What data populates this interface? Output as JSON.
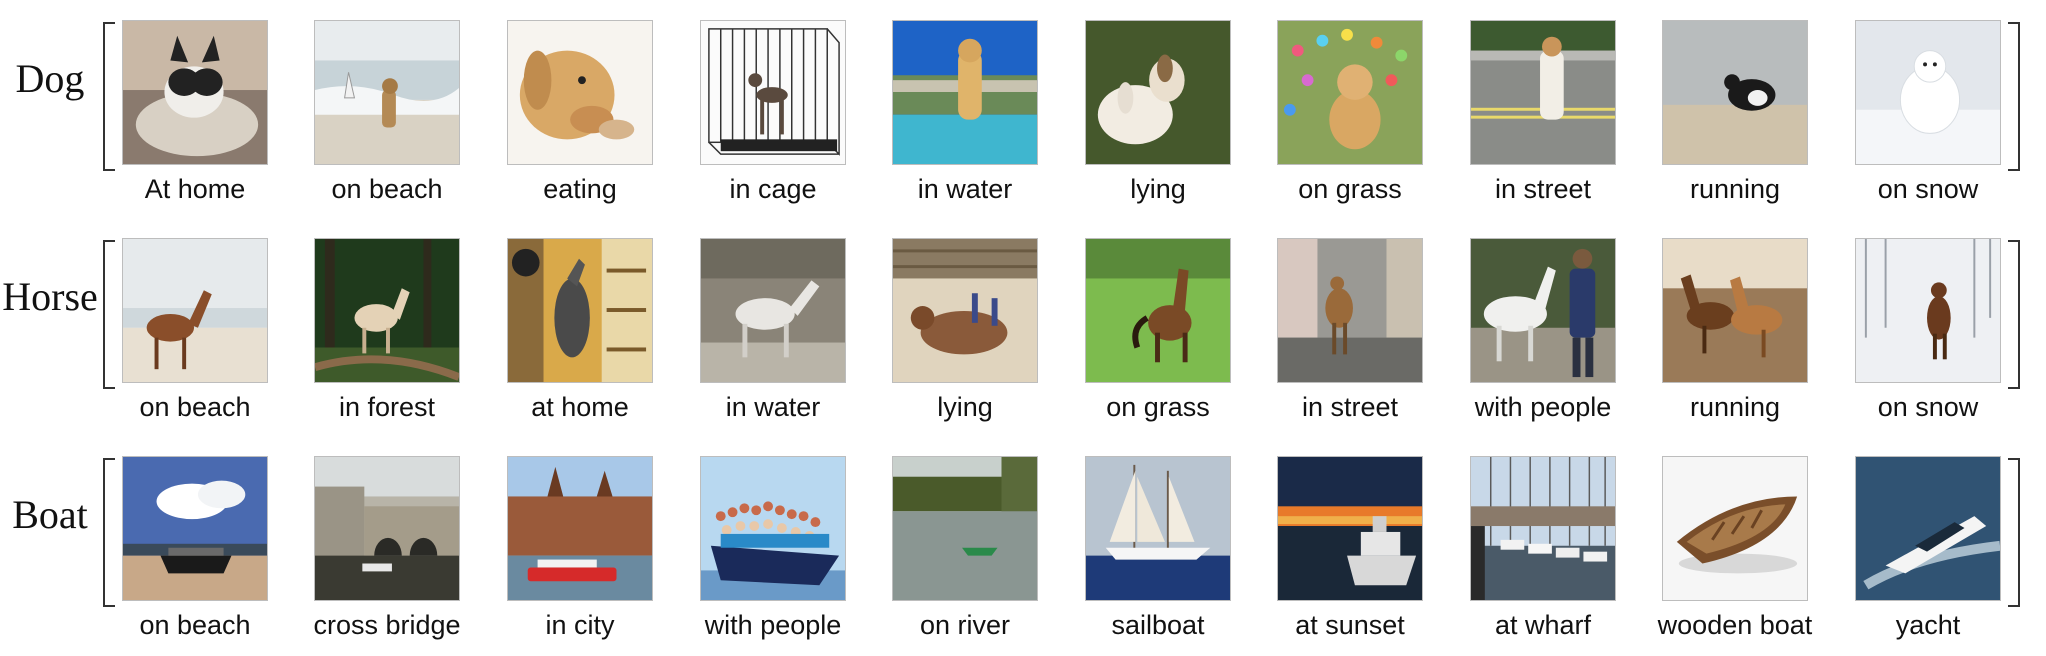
{
  "rows": [
    {
      "label": "Dog",
      "captions": [
        "At home",
        "on beach",
        "eating",
        "in cage",
        "in water",
        "lying",
        "on grass",
        "in street",
        "running",
        "on snow"
      ],
      "scenes": [
        "home",
        "beach",
        "eating",
        "cage",
        "water",
        "lying",
        "grass",
        "street",
        "running",
        "snow"
      ]
    },
    {
      "label": "Horse",
      "captions": [
        "on beach",
        "in forest",
        "at home",
        "in water",
        "lying",
        "on grass",
        "in street",
        "with people",
        "running",
        "on snow"
      ],
      "scenes": [
        "beach",
        "forest",
        "home",
        "water",
        "lying",
        "grass",
        "street",
        "people",
        "running",
        "snow"
      ]
    },
    {
      "label": "Boat",
      "captions": [
        "on beach",
        "cross bridge",
        "in city",
        "with people",
        "on river",
        "sailboat",
        "at sunset",
        "at wharf",
        "wooden boat",
        "yacht"
      ],
      "scenes": [
        "beach",
        "bridge",
        "city",
        "people",
        "river",
        "sailboat",
        "sunset",
        "wharf",
        "wooden",
        "yacht"
      ]
    }
  ]
}
